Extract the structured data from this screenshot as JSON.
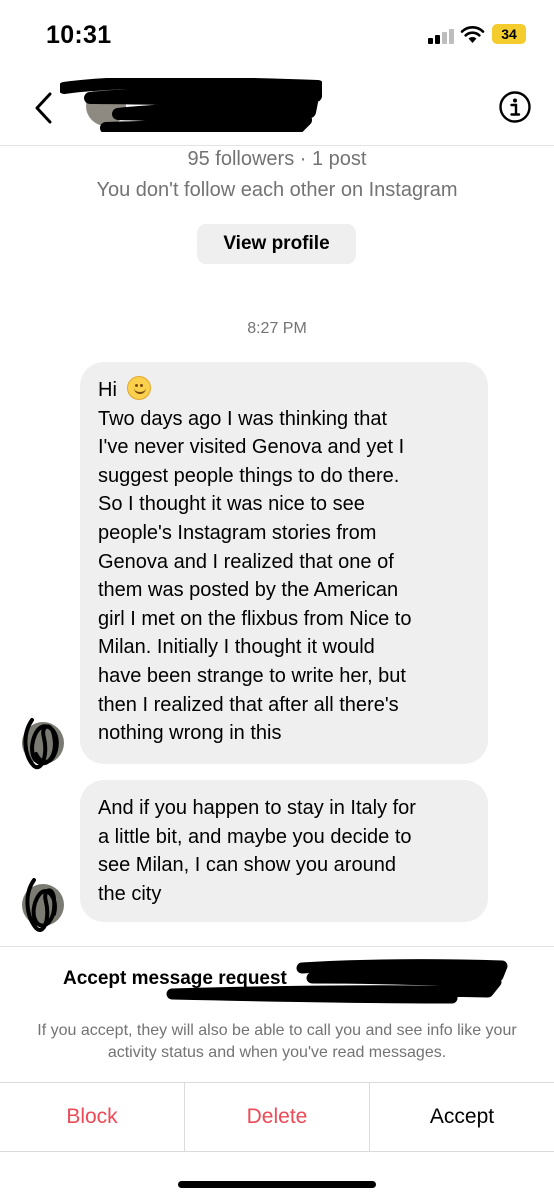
{
  "status_bar": {
    "time": "10:31",
    "battery": "34",
    "icons": [
      "cellular-signal-icon",
      "wifi-icon",
      "battery-icon"
    ]
  },
  "header": {
    "back_icon": "chevron-left-icon",
    "info_icon": "info-circle-icon"
  },
  "profile": {
    "followers_line": "95 followers · 1 post",
    "relation_line": "You don't follow each other on Instagram",
    "view_profile_label": "View profile"
  },
  "conversation": {
    "timestamp": "8:27 PM",
    "messages": [
      {
        "lines": [
          "Hi",
          "Two days ago I was thinking that",
          "I've never visited Genova and yet I",
          "suggest people things to do there.",
          "So I thought it was nice to see",
          "people's Instagram stories from",
          "Genova and I realized that one of",
          "them was posted by the American",
          "girl I met on the flixbus from Nice to",
          "Milan. Initially I thought it would",
          "have been strange to write her, but",
          "then I realized that after all there's",
          "nothing wrong in this"
        ],
        "emoji": "smiling-face-emoji"
      },
      {
        "lines": [
          "And if you happen to stay in Italy for",
          "a little bit, and maybe you decide to",
          "see Milan, I can show you around",
          "the city"
        ]
      }
    ]
  },
  "request": {
    "title": "Accept message request",
    "info": "If you accept, they will also be able to call you and see info like your activity status and when you've read messages.",
    "actions": {
      "block": "Block",
      "delete": "Delete",
      "accept": "Accept"
    }
  },
  "colors": {
    "destructive": "#ed4956",
    "secondary_text": "#737373",
    "bubble": "#efefef",
    "battery": "#f5cc2e"
  }
}
